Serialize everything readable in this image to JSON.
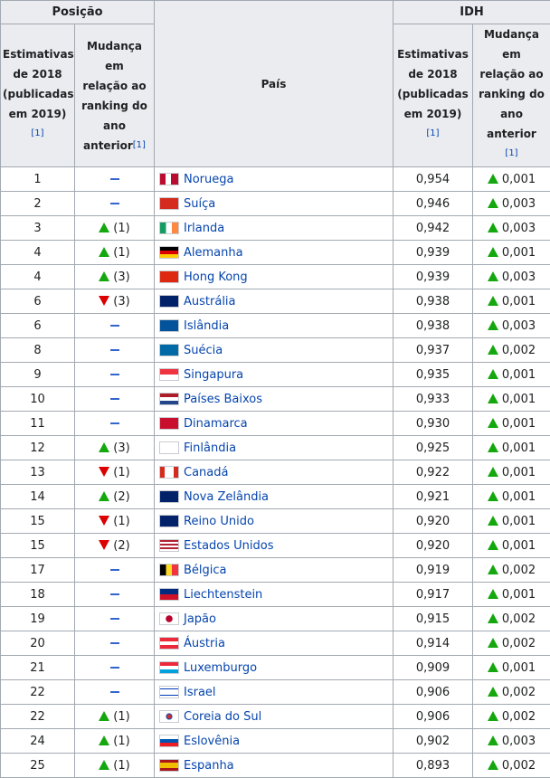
{
  "headers": {
    "position": "Posição",
    "country": "País",
    "idh": "IDH",
    "estimates": [
      "Estimativas",
      "de 2018",
      "(publicadas",
      "em 2019)"
    ],
    "change": [
      "Mudança em",
      "relação ao",
      "ranking do",
      "ano"
    ],
    "change_last": "anterior",
    "change_idh": [
      "Mudança em",
      "relação ao",
      "ranking do",
      "ano anterior"
    ],
    "ref": "[1]"
  },
  "colors": {
    "up": "#14a70e",
    "down": "#dd0000",
    "dash": "#3366cc",
    "link": "#0645ad"
  },
  "rows": [
    {
      "rank": "1",
      "change_dir": "none",
      "change_text": "",
      "country": "Noruega",
      "flag": "norway-flag-icon",
      "idh": "0,954",
      "idh_change": "0,001"
    },
    {
      "rank": "2",
      "change_dir": "none",
      "change_text": "",
      "country": "Suíça",
      "flag": "switzerland-flag-icon",
      "idh": "0,946",
      "idh_change": "0,003"
    },
    {
      "rank": "3",
      "change_dir": "up",
      "change_text": "(1)",
      "country": "Irlanda",
      "flag": "ireland-flag-icon",
      "idh": "0,942",
      "idh_change": "0,003"
    },
    {
      "rank": "4",
      "change_dir": "up",
      "change_text": "(1)",
      "country": "Alemanha",
      "flag": "germany-flag-icon",
      "idh": "0,939",
      "idh_change": "0,001"
    },
    {
      "rank": "4",
      "change_dir": "up",
      "change_text": "(3)",
      "country": "Hong Kong",
      "flag": "hongkong-flag-icon",
      "idh": "0,939",
      "idh_change": "0,003"
    },
    {
      "rank": "6",
      "change_dir": "down",
      "change_text": "(3)",
      "country": "Austrália",
      "flag": "australia-flag-icon",
      "idh": "0,938",
      "idh_change": "0,001"
    },
    {
      "rank": "6",
      "change_dir": "none",
      "change_text": "",
      "country": "Islândia",
      "flag": "iceland-flag-icon",
      "idh": "0,938",
      "idh_change": "0,003"
    },
    {
      "rank": "8",
      "change_dir": "none",
      "change_text": "",
      "country": "Suécia",
      "flag": "sweden-flag-icon",
      "idh": "0,937",
      "idh_change": "0,002"
    },
    {
      "rank": "9",
      "change_dir": "none",
      "change_text": "",
      "country": "Singapura",
      "flag": "singapore-flag-icon",
      "idh": "0,935",
      "idh_change": "0,001"
    },
    {
      "rank": "10",
      "change_dir": "none",
      "change_text": "",
      "country": "Países Baixos",
      "flag": "netherlands-flag-icon",
      "idh": "0,933",
      "idh_change": "0,001"
    },
    {
      "rank": "11",
      "change_dir": "none",
      "change_text": "",
      "country": "Dinamarca",
      "flag": "denmark-flag-icon",
      "idh": "0,930",
      "idh_change": "0,001"
    },
    {
      "rank": "12",
      "change_dir": "up",
      "change_text": "(3)",
      "country": "Finlândia",
      "flag": "finland-flag-icon",
      "idh": "0,925",
      "idh_change": "0,001"
    },
    {
      "rank": "13",
      "change_dir": "down",
      "change_text": "(1)",
      "country": "Canadá",
      "flag": "canada-flag-icon",
      "idh": "0,922",
      "idh_change": "0,001"
    },
    {
      "rank": "14",
      "change_dir": "up",
      "change_text": "(2)",
      "country": "Nova Zelândia",
      "flag": "newzealand-flag-icon",
      "idh": "0,921",
      "idh_change": "0,001"
    },
    {
      "rank": "15",
      "change_dir": "down",
      "change_text": "(1)",
      "country": "Reino Unido",
      "flag": "uk-flag-icon",
      "idh": "0,920",
      "idh_change": "0,001"
    },
    {
      "rank": "15",
      "change_dir": "down",
      "change_text": "(2)",
      "country": "Estados Unidos",
      "flag": "usa-flag-icon",
      "idh": "0,920",
      "idh_change": "0,001"
    },
    {
      "rank": "17",
      "change_dir": "none",
      "change_text": "",
      "country": "Bélgica",
      "flag": "belgium-flag-icon",
      "idh": "0,919",
      "idh_change": "0,002"
    },
    {
      "rank": "18",
      "change_dir": "none",
      "change_text": "",
      "country": "Liechtenstein",
      "flag": "liechtenstein-flag-icon",
      "idh": "0,917",
      "idh_change": "0,001"
    },
    {
      "rank": "19",
      "change_dir": "none",
      "change_text": "",
      "country": "Japão",
      "flag": "japan-flag-icon",
      "idh": "0,915",
      "idh_change": "0,002"
    },
    {
      "rank": "20",
      "change_dir": "none",
      "change_text": "",
      "country": "Áustria",
      "flag": "austria-flag-icon",
      "idh": "0,914",
      "idh_change": "0,002"
    },
    {
      "rank": "21",
      "change_dir": "none",
      "change_text": "",
      "country": "Luxemburgo",
      "flag": "luxembourg-flag-icon",
      "idh": "0,909",
      "idh_change": "0,001"
    },
    {
      "rank": "22",
      "change_dir": "none",
      "change_text": "",
      "country": "Israel",
      "flag": "israel-flag-icon",
      "idh": "0,906",
      "idh_change": "0,002"
    },
    {
      "rank": "22",
      "change_dir": "up",
      "change_text": "(1)",
      "country": "Coreia do Sul",
      "flag": "southkorea-flag-icon",
      "idh": "0,906",
      "idh_change": "0,002"
    },
    {
      "rank": "24",
      "change_dir": "up",
      "change_text": "(1)",
      "country": "Eslovênia",
      "flag": "slovenia-flag-icon",
      "idh": "0,902",
      "idh_change": "0,003"
    },
    {
      "rank": "25",
      "change_dir": "up",
      "change_text": "(1)",
      "country": "Espanha",
      "flag": "spain-flag-icon",
      "idh": "0,893",
      "idh_change": "0,002"
    }
  ]
}
